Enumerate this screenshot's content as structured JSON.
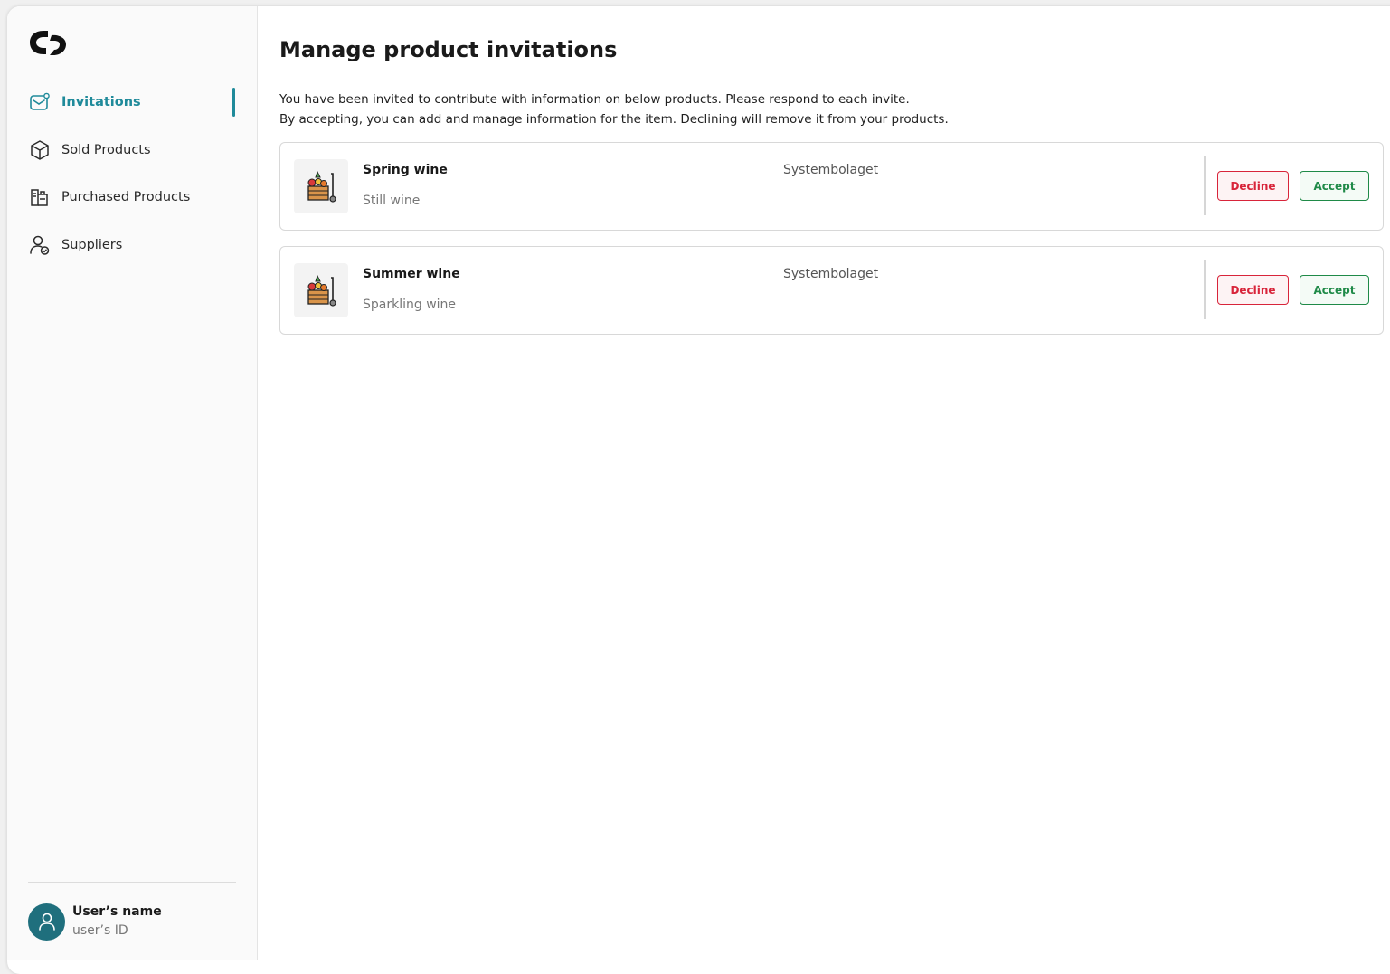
{
  "sidebar": {
    "items": [
      {
        "label": "Invitations",
        "icon": "mail-icon",
        "active": true
      },
      {
        "label": "Sold Products",
        "icon": "box-icon",
        "active": false
      },
      {
        "label": "Purchased Products",
        "icon": "purchased-icon",
        "active": false
      },
      {
        "label": "Suppliers",
        "icon": "user-group-icon",
        "active": false
      }
    ],
    "user": {
      "name": "User’s name",
      "id": "user’s ID"
    }
  },
  "main": {
    "title": "Manage product invitations",
    "description_line1": "You have been invited to contribute with information on below products. Please respond to each invite.",
    "description_line2": "By accepting, you can add and manage information for the item. Declining will remove it from your products.",
    "invitations": [
      {
        "name": "Spring wine",
        "type": "Still wine",
        "supplier": "Systembolaget",
        "decline_label": "Decline",
        "accept_label": "Accept"
      },
      {
        "name": "Summer wine",
        "type": "Sparkling wine",
        "supplier": "Systembolaget",
        "decline_label": "Decline",
        "accept_label": "Accept"
      }
    ]
  },
  "colors": {
    "accent": "#1f8a9a",
    "decline": "#d8243a",
    "accept": "#1f8a48",
    "avatar": "#1f6f7d"
  }
}
